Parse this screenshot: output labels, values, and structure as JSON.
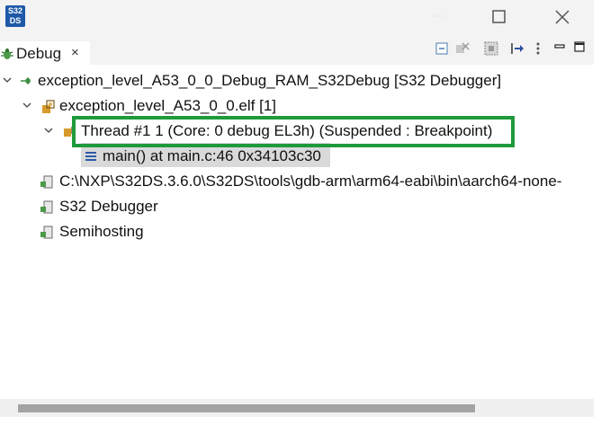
{
  "app": {
    "logo_text": "S32 DS",
    "accent_color": "#1e9a3c"
  },
  "window_controls": {
    "minimize": "minimize-icon",
    "maximize": "maximize-icon",
    "close": "close-icon"
  },
  "view": {
    "tab_label": "Debug",
    "tab_close": "×",
    "toolbar_icons": [
      "collapse-all-icon",
      "remove-terminated-icon",
      "debug-options-icon",
      "step-filter-icon",
      "view-menu-icon",
      "minimize-view-icon",
      "maximize-view-icon"
    ]
  },
  "tree": {
    "launch": "exception_level_A53_0_0_Debug_RAM_S32Debug [S32 Debugger]",
    "elf": "exception_level_A53_0_0.elf [1]",
    "thread": "Thread #1 1 (Core: 0 debug EL3h) (Suspended : Breakpoint)",
    "frame": "main() at main.c:46 0x34103c30",
    "process_gdb": "C:\\NXP\\S32DS.3.6.0\\S32DS\\tools\\gdb-arm\\arm64-eabi\\bin\\aarch64-none-",
    "process_debugger": "S32 Debugger",
    "process_semihosting": "Semihosting"
  }
}
